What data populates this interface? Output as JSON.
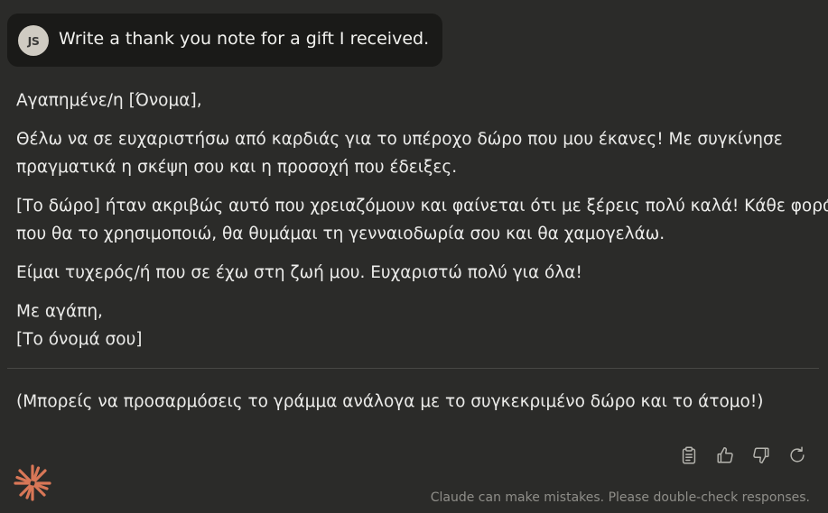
{
  "user_message": {
    "avatar_initials": "JS",
    "text": "Write a thank you note for a gift I received."
  },
  "response": {
    "greeting": "Αγαπημένε/η [Όνομα],",
    "paragraph1": [
      "Θέλω να σε ευχαριστήσω από καρδιάς για το υπέροχο δώρο που μου έκανες! Με συγκίνησε",
      "πραγματικά η σκέψη σου και η προσοχή που έδειξες."
    ],
    "paragraph2": [
      "[Το δώρο] ήταν ακριβώς αυτό που χρειαζόμουν και φαίνεται ότι με ξέρεις πολύ καλά! Κάθε φορά",
      "που θα το χρησιμοποιώ, θα θυμάμαι τη γενναιοδωρία σου και θα χαμογελάω."
    ],
    "paragraph3": "Είμαι τυχερός/ή που σε έχω στη ζωή μου. Ευχαριστώ πολύ για όλα!",
    "closing": "Με αγάπη,",
    "signature": "[Το όνομά σου]",
    "footnote": "(Μπορείς να προσαρμόσεις το γράμμα ανάλογα με το συγκεκριμένο δώρο και το άτομο!)"
  },
  "actions": [
    {
      "icon": "clipboard-icon"
    },
    {
      "icon": "thumbs-up-icon"
    },
    {
      "icon": "thumbs-down-icon"
    },
    {
      "icon": "retry-icon"
    }
  ],
  "colors": {
    "background": "#2b2b29",
    "user_bubble": "#1a1a18",
    "text": "#ececea",
    "muted": "#8f8e89",
    "brand_accent": "#d97757"
  },
  "footer": {
    "disclaimer": "Claude can make mistakes. Please double-check responses."
  }
}
